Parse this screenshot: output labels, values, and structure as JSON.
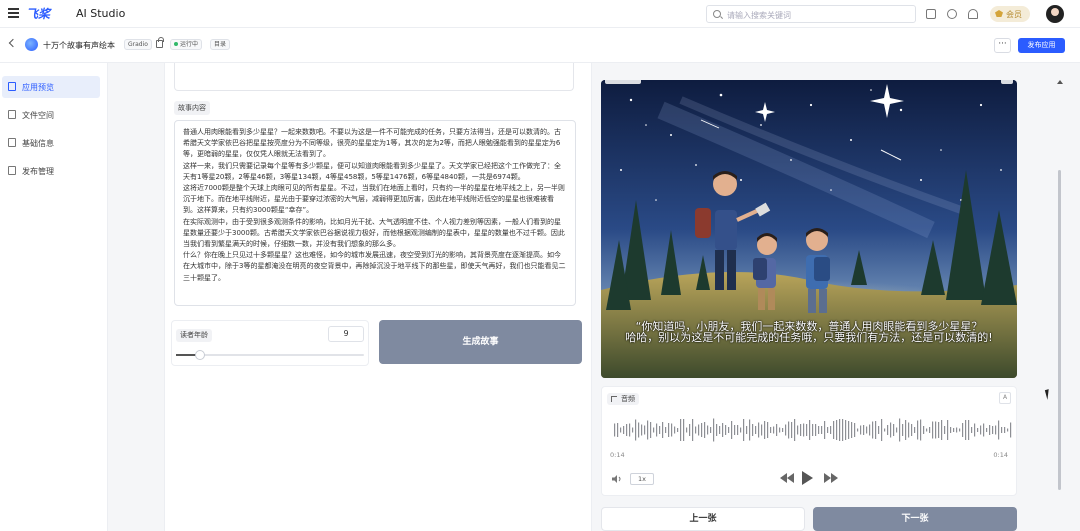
{
  "header": {
    "logo": "飞桨",
    "app_title": "AI Studio",
    "search_placeholder": "请输入搜索关键词",
    "vip_label": "会员"
  },
  "appbar": {
    "app_name": "十万个故事有声绘本",
    "framework_tag": "Gradio",
    "status_tag": "运行中",
    "catalog_tag": "目录",
    "more_label": "···",
    "publish_label": "发布应用"
  },
  "sidebar": {
    "items": [
      {
        "label": "应用预览",
        "active": true
      },
      {
        "label": "文件空间",
        "active": false
      },
      {
        "label": "基础信息",
        "active": false
      },
      {
        "label": "发布管理",
        "active": false
      }
    ]
  },
  "left_panel": {
    "story_label": "故事内容",
    "story_text": [
      "普通人用肉眼能看到多少星星？一起来数数吧。不要以为这是一件不可能完成的任务，只要方法得当，还是可以数清的。古希腊天文学家依巴谷把星星按亮度分为不同等级，很亮的星星定为1等，其次的定为2等，而把人眼勉强能看到的星星定为6等，更暗弱的星星，仅仅凭人眼就无法看到了。",
      "这样一来，我们只需要记录每个星等有多少颗星，便可以知道肉眼能看到多少星星了。天文学家已经把这个工作做完了：全天有1等星20颗，2等星46颗，3等星134颗，4等星458颗，5等星1476颗，6等星4840颗，一共是6974颗。",
      "这将近7000颗是整个天球上肉眼可见的所有星星。不过，当我们在地面上看时，只有约一半的星星在地平线之上，另一半则沉于地下。而在地平线附近，星光由于要穿过浓密的大气层，减弱得更加厉害，因此在地平线附近低空的星星也很难被看到。这样算来，只有约3000颗星“幸存”。",
      "在实际观测中，由于受到很多观测条件的影响，比如月光干扰、大气透明度不佳、个人视力差别等因素，一般人们看到的星星数量还要少于3000颗。古希腊天文学家依巴谷据说视力极好，而他根据观测编制的星表中，星星的数量也不过千颗。因此当我们看到繁星满天的时候，仔细数一数，并没有我们想象的那么多。",
      "什么？你在晚上只见过十多颗星星？这也难怪，如今的城市发展迅速，夜空受到灯光的影响，其背景亮度在逐渐提高。如今在大城市中，除于3等的星都淹没在明亮的夜空背景中，再除掉沉没于地平线下的那些星，即使天气再好，我们也只能看见二三十颗星了。"
    ],
    "age_label": "读者年龄",
    "age_value": "9",
    "age_fraction": 0.13,
    "generate_label": "生成故事"
  },
  "right_panel": {
    "caption_line1": "“你知道吗，小朋友，我们一起来数数，普通人用肉眼能看到多少星星？",
    "caption_line2": "哈哈，别以为这是不可能完成的任务哦，只要我们有方法，还是可以数清的!",
    "audio_label": "音频",
    "time_current": "0:14",
    "time_total": "0:14",
    "playback_rate": "1x",
    "prev_label": "上一张",
    "next_label": "下一张"
  }
}
